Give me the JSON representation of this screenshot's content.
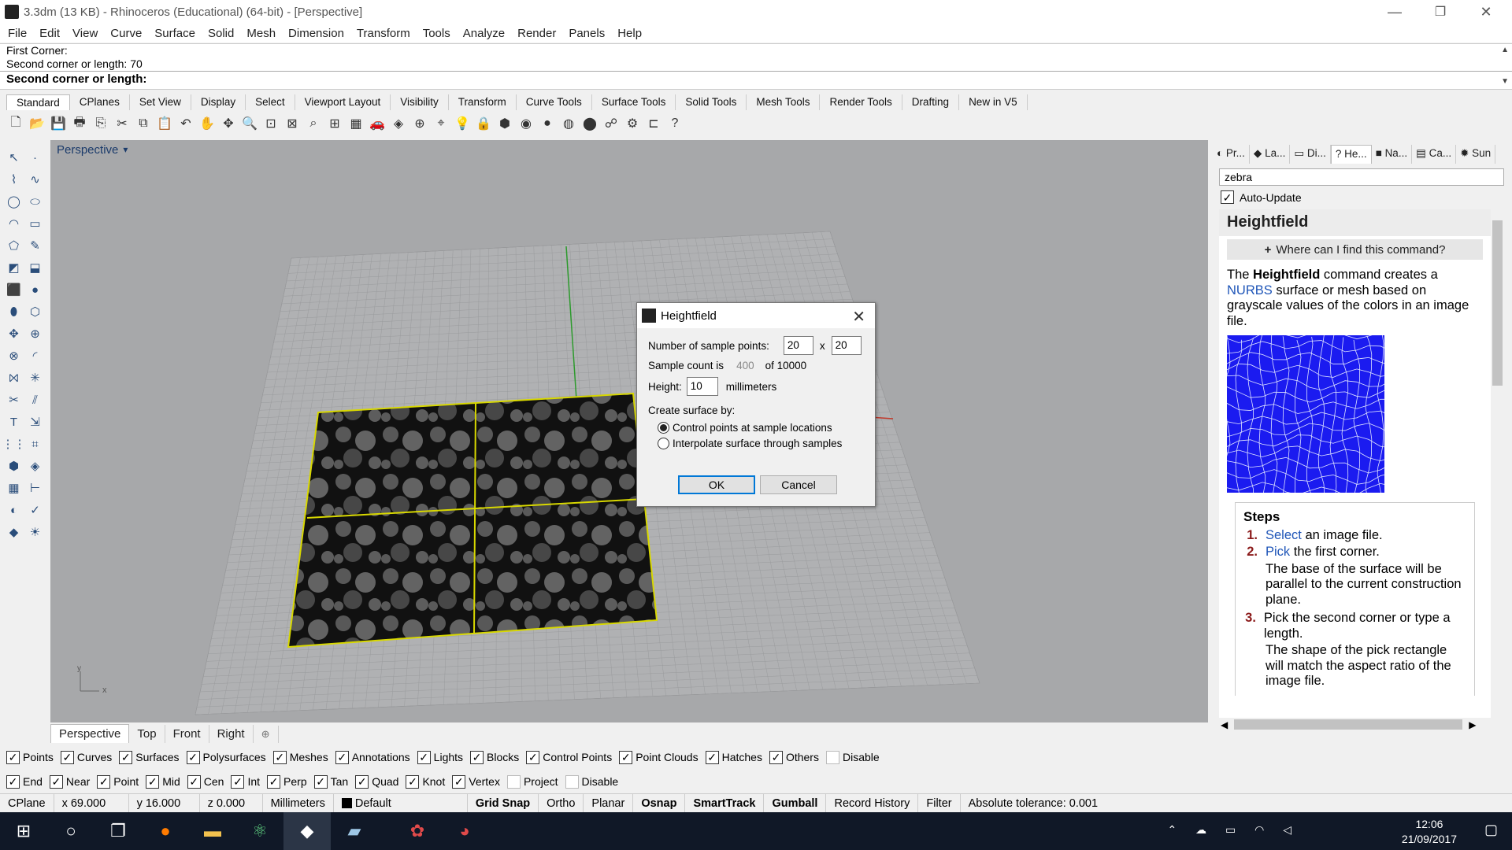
{
  "window": {
    "title": "3.3dm (13 KB) - Rhinoceros (Educational) (64-bit) - [Perspective]",
    "minimize": "—",
    "restore": "❐",
    "close": "✕"
  },
  "menu": [
    "File",
    "Edit",
    "View",
    "Curve",
    "Surface",
    "Solid",
    "Mesh",
    "Dimension",
    "Transform",
    "Tools",
    "Analyze",
    "Render",
    "Panels",
    "Help"
  ],
  "command_history": {
    "line1": "First Corner:",
    "line2": "Second corner or length: 70",
    "prompt": "Second corner or length:"
  },
  "toolbar_tabs": [
    "Standard",
    "CPlanes",
    "Set View",
    "Display",
    "Select",
    "Viewport Layout",
    "Visibility",
    "Transform",
    "Curve Tools",
    "Surface Tools",
    "Solid Tools",
    "Mesh Tools",
    "Render Tools",
    "Drafting",
    "New in V5"
  ],
  "toolbar_icons": [
    {
      "name": "new-icon",
      "glyph": "🗋"
    },
    {
      "name": "open-icon",
      "glyph": "📂"
    },
    {
      "name": "save-icon",
      "glyph": "💾"
    },
    {
      "name": "print-icon",
      "glyph": "🖶"
    },
    {
      "name": "export-icon",
      "glyph": "⎘"
    },
    {
      "name": "cut-icon",
      "glyph": "✂"
    },
    {
      "name": "copy-icon",
      "glyph": "⧉"
    },
    {
      "name": "paste-icon",
      "glyph": "📋"
    },
    {
      "name": "undo-icon",
      "glyph": "↶"
    },
    {
      "name": "pan-icon",
      "glyph": "✋"
    },
    {
      "name": "rotate-view-icon",
      "glyph": "✥"
    },
    {
      "name": "zoom-icon",
      "glyph": "🔍"
    },
    {
      "name": "zoom-window-icon",
      "glyph": "⊡"
    },
    {
      "name": "zoom-extents-icon",
      "glyph": "⊠"
    },
    {
      "name": "zoom-selected-icon",
      "glyph": "⌕"
    },
    {
      "name": "viewport-layout-icon",
      "glyph": "⊞"
    },
    {
      "name": "grid-icon",
      "glyph": "▦"
    },
    {
      "name": "car-icon",
      "glyph": "🚗"
    },
    {
      "name": "named-view-icon",
      "glyph": "◈"
    },
    {
      "name": "cplane-icon",
      "glyph": "⊕"
    },
    {
      "name": "osnap-icon",
      "glyph": "⌖"
    },
    {
      "name": "light-icon",
      "glyph": "💡"
    },
    {
      "name": "lock-icon",
      "glyph": "🔒"
    },
    {
      "name": "layer-icon",
      "glyph": "⬢"
    },
    {
      "name": "color-icon",
      "glyph": "◉"
    },
    {
      "name": "render-preview-icon",
      "glyph": "●"
    },
    {
      "name": "rendered-icon",
      "glyph": "◍"
    },
    {
      "name": "material-icon",
      "glyph": "⬤"
    },
    {
      "name": "properties-icon",
      "glyph": "☍"
    },
    {
      "name": "options-icon",
      "glyph": "⚙"
    },
    {
      "name": "dims-icon",
      "glyph": "⊏"
    },
    {
      "name": "help-icon",
      "glyph": "?"
    }
  ],
  "left_tools": [
    "select-arrow-icon",
    "point-icon",
    "polyline-icon",
    "curve-icon",
    "circle-icon",
    "ellipse-icon",
    "arc-icon",
    "rectangle-icon",
    "polygon-icon",
    "freeform-icon",
    "surface-corner-icon",
    "extrude-icon",
    "box-icon",
    "sphere-icon",
    "cylinder-icon",
    "mesh-icon",
    "move-icon",
    "gumball-icon",
    "boolean-icon",
    "fillet-icon",
    "join-icon",
    "explode-icon",
    "trim-icon",
    "split-icon",
    "text-icon",
    "transform-icon",
    "array-icon",
    "analyze-icon",
    "solid-icon",
    "render-icon",
    "grid-array-icon",
    "dimension-icon",
    "paint-icon",
    "check-icon",
    "render-mesh-icon",
    "sun-icon"
  ],
  "viewport": {
    "label": "Perspective",
    "menu_arrow": "▾",
    "axis_y": "y",
    "axis_x": "x"
  },
  "view_tabs": [
    "Perspective",
    "Top",
    "Front",
    "Right"
  ],
  "view_tab_add": "⊕",
  "object_filters": [
    {
      "label": "Points",
      "checked": true
    },
    {
      "label": "Curves",
      "checked": true
    },
    {
      "label": "Surfaces",
      "checked": true
    },
    {
      "label": "Polysurfaces",
      "checked": true
    },
    {
      "label": "Meshes",
      "checked": true
    },
    {
      "label": "Annotations",
      "checked": true
    },
    {
      "label": "Lights",
      "checked": true
    },
    {
      "label": "Blocks",
      "checked": true
    },
    {
      "label": "Control Points",
      "checked": true
    },
    {
      "label": "Point Clouds",
      "checked": true
    },
    {
      "label": "Hatches",
      "checked": true
    },
    {
      "label": "Others",
      "checked": true
    },
    {
      "label": "Disable",
      "checked": false
    }
  ],
  "osnaps": [
    {
      "label": "End",
      "checked": true
    },
    {
      "label": "Near",
      "checked": true
    },
    {
      "label": "Point",
      "checked": true
    },
    {
      "label": "Mid",
      "checked": true
    },
    {
      "label": "Cen",
      "checked": true
    },
    {
      "label": "Int",
      "checked": true
    },
    {
      "label": "Perp",
      "checked": true
    },
    {
      "label": "Tan",
      "checked": true
    },
    {
      "label": "Quad",
      "checked": true
    },
    {
      "label": "Knot",
      "checked": true
    },
    {
      "label": "Vertex",
      "checked": true
    },
    {
      "label": "Project",
      "checked": false
    },
    {
      "label": "Disable",
      "checked": false
    }
  ],
  "status": {
    "cplane": "CPlane",
    "x": "x 69.000",
    "y": "y 16.000",
    "z": "z 0.000",
    "units": "Millimeters",
    "layer": "Default",
    "layer_color": "#000000",
    "grid_snap": "Grid Snap",
    "ortho": "Ortho",
    "planar": "Planar",
    "osnap": "Osnap",
    "smarttrack": "SmartTrack",
    "gumball": "Gumball",
    "record_history": "Record History",
    "filter": "Filter",
    "tolerance": "Absolute tolerance: 0.001"
  },
  "panel": {
    "tabs": [
      "Pr...",
      "La...",
      "Di...",
      "He...",
      "Na...",
      "Ca...",
      "Sun"
    ],
    "active_tab": 3,
    "search": "zebra",
    "auto_update": "Auto-Update",
    "title": "Heightfield",
    "where": "Where can I find this command?",
    "where_plus": "+",
    "desc_1": "The ",
    "desc_cmd": "Heightfield",
    "desc_2": " command creates a ",
    "desc_link": "NURBS",
    "desc_3": " surface or mesh based on grayscale values of the colors in an image file.",
    "steps_title": "Steps",
    "step1_n": "1.",
    "step1_link": "Select",
    "step1_text": " an image file.",
    "step2_n": "2.",
    "step2_link": "Pick",
    "step2_text": " the first corner.",
    "step2_sub": "The base of the surface will be parallel to the current construction plane.",
    "step3_n": "3.",
    "step3_text": "Pick the second corner or type a length.",
    "step3_sub": "The shape of the pick rectangle will match the aspect ratio of the image file."
  },
  "dialog": {
    "title": "Heightfield",
    "close": "✕",
    "sample_label": "Number of sample points:",
    "sample_x": "20",
    "sample_times": "x",
    "sample_y": "20",
    "count_label": "Sample count is",
    "count_value": "400",
    "count_of": "of 10000",
    "height_label": "Height:",
    "height_value": "10",
    "height_units": "millimeters",
    "create_label": "Create surface by:",
    "option1": "Control points at sample locations",
    "option2": "Interpolate surface through samples",
    "selected_option": 1,
    "ok": "OK",
    "cancel": "Cancel"
  },
  "taskbar": {
    "time": "12:06",
    "date": "21/09/2017",
    "apps": [
      "start-icon",
      "cortana-icon",
      "task-view-icon",
      "firefox-icon",
      "file-explorer-icon",
      "atom-icon",
      "rhino-icon",
      "notes-icon",
      "settings-icon",
      "chrome-icon"
    ]
  }
}
